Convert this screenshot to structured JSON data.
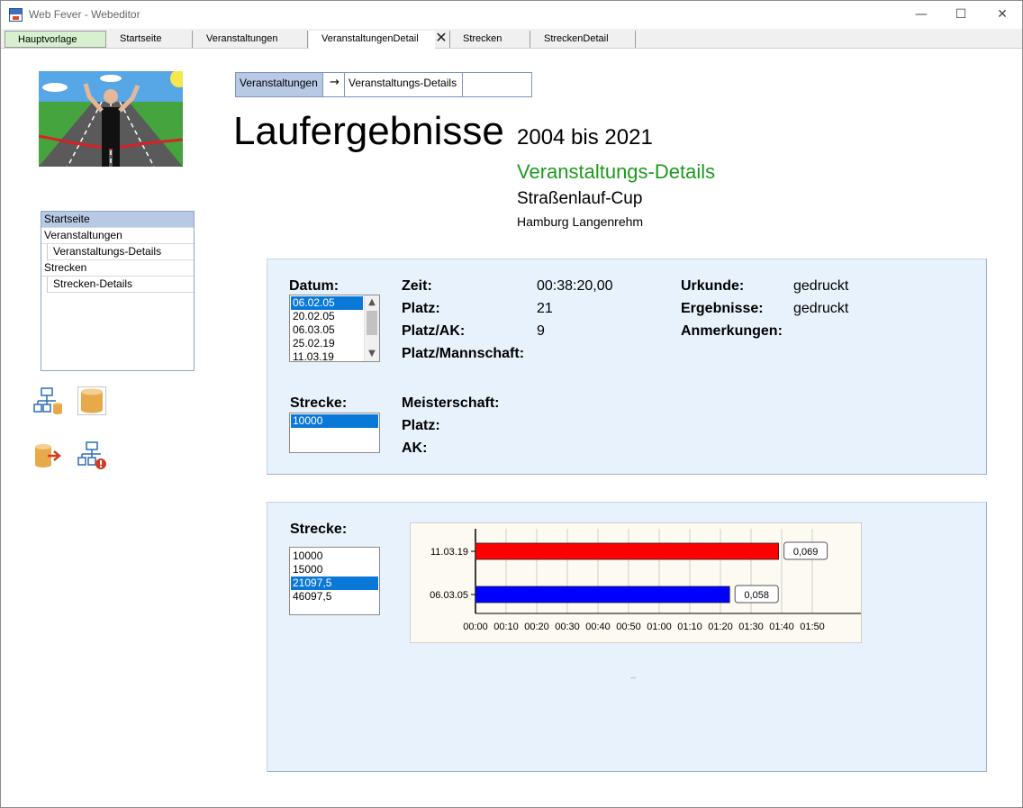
{
  "window": {
    "title": "Web Fever - Webeditor",
    "minimize": "—",
    "maximize": "☐",
    "close": "✕"
  },
  "tabs": [
    {
      "label": "Hauptvorlage"
    },
    {
      "label": "Startseite"
    },
    {
      "label": "Veranstaltungen"
    },
    {
      "label": "VeranstaltungenDetail",
      "active": true
    },
    {
      "label": "Strecken"
    },
    {
      "label": "StreckenDetail"
    }
  ],
  "tab_close_glyph": "✕",
  "nav": {
    "items": [
      {
        "label": "Startseite",
        "selected": true
      },
      {
        "label": "Veranstaltungen"
      },
      {
        "label": "Veranstaltungs-Details",
        "child": true
      },
      {
        "label": "Strecken"
      },
      {
        "label": "Strecken-Details",
        "child": true
      }
    ]
  },
  "toolbar_icons": [
    "sitemap-database-icon",
    "database-icon",
    "database-export-icon",
    "sitemap-alert-icon"
  ],
  "breadcrumb": {
    "first": "Veranstaltungen",
    "arrow": "→",
    "second": "Veranstaltungs-Details"
  },
  "header": {
    "title": "Laufergebnisse",
    "years": "2004 bis 2021",
    "section": "Veranstaltungs-Details",
    "event": "Straßenlauf-Cup",
    "location": "Hamburg Langenrehm"
  },
  "details": {
    "datum_label": "Datum:",
    "dates": [
      "06.02.05",
      "20.02.05",
      "06.03.05",
      "25.02.19",
      "11.03.19"
    ],
    "selected_date": "06.02.05",
    "strecke_label": "Strecke:",
    "strecken": [
      "10000"
    ],
    "selected_strecke": "10000",
    "zeit_label": "Zeit:",
    "zeit": "00:38:20,00",
    "platz_label": "Platz:",
    "platz": "21",
    "platz_ak_label": "Platz/AK:",
    "platz_ak": "9",
    "platz_mannschaft_label": "Platz/Mannschaft:",
    "urkunde_label": "Urkunde:",
    "urkunde": "gedruckt",
    "ergebnisse_label": "Ergebnisse:",
    "ergebnisse": "gedruckt",
    "anmerkungen_label": "Anmerkungen:",
    "meisterschaft_label": "Meisterschaft:",
    "platz2_label": "Platz:",
    "ak_label": "AK:"
  },
  "chart_panel": {
    "strecke_label": "Strecke:",
    "strecken": [
      "10000",
      "15000",
      "21097,5",
      "46097,5"
    ],
    "selected": "21097,5"
  },
  "chart_data": {
    "type": "bar",
    "orientation": "horizontal",
    "categories": [
      "11.03.19",
      "06.03.05"
    ],
    "values_minutes": [
      99,
      83
    ],
    "value_labels": [
      "0,069",
      "0,058"
    ],
    "colors": [
      "#ff0000",
      "#0000ff"
    ],
    "x_ticks": [
      "00:00",
      "00:10",
      "00:20",
      "00:30",
      "00:40",
      "00:50",
      "01:00",
      "01:10",
      "01:20",
      "01:30",
      "01:40",
      "01:50"
    ],
    "xlim_minutes": [
      0,
      110
    ],
    "grid": true
  }
}
